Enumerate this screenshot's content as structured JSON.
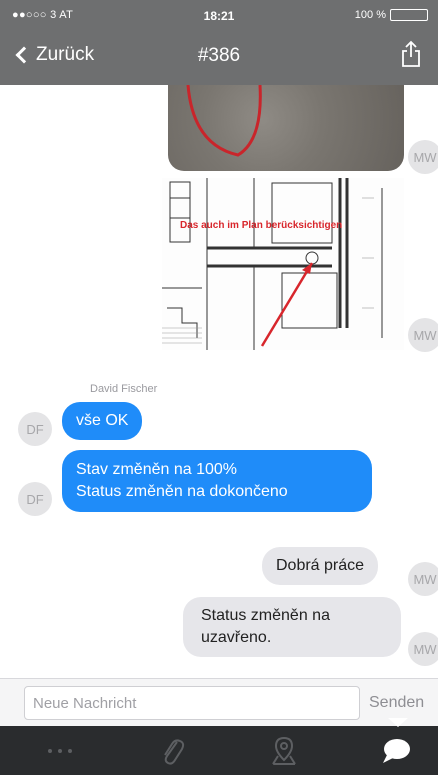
{
  "status_bar": {
    "carrier": "●●○○○ 3 AT",
    "time": "18:21",
    "battery": "100 %",
    "battery_level": 1.0
  },
  "nav": {
    "back_label": "Zurück",
    "title": "#386"
  },
  "images": {
    "plan_annotation": "Das auch im Plan berücksichtigen"
  },
  "messages": [
    {
      "avatar": "MW"
    },
    {
      "avatar": "MW"
    },
    {
      "sender": "David Fischer"
    },
    {
      "avatar": "DF",
      "text": "vše OK"
    },
    {
      "avatar": "DF",
      "line1": "Stav změněn na 100%",
      "line2": "Status změněn na dokončeno"
    },
    {
      "avatar": "MW",
      "text": "Dobrá práce"
    },
    {
      "avatar": "MW",
      "line1": "Status změněn na",
      "line2": "uzavřeno."
    }
  ],
  "composer": {
    "placeholder": "Neue Nachricht",
    "send_label": "Senden"
  },
  "tabs": [
    "more-icon",
    "attachment-icon",
    "location-icon",
    "chat-icon"
  ],
  "colors": {
    "accent": "#1f8cf9",
    "nav_background": "#6e6f70",
    "tab_bar": "#2a2c2e"
  }
}
